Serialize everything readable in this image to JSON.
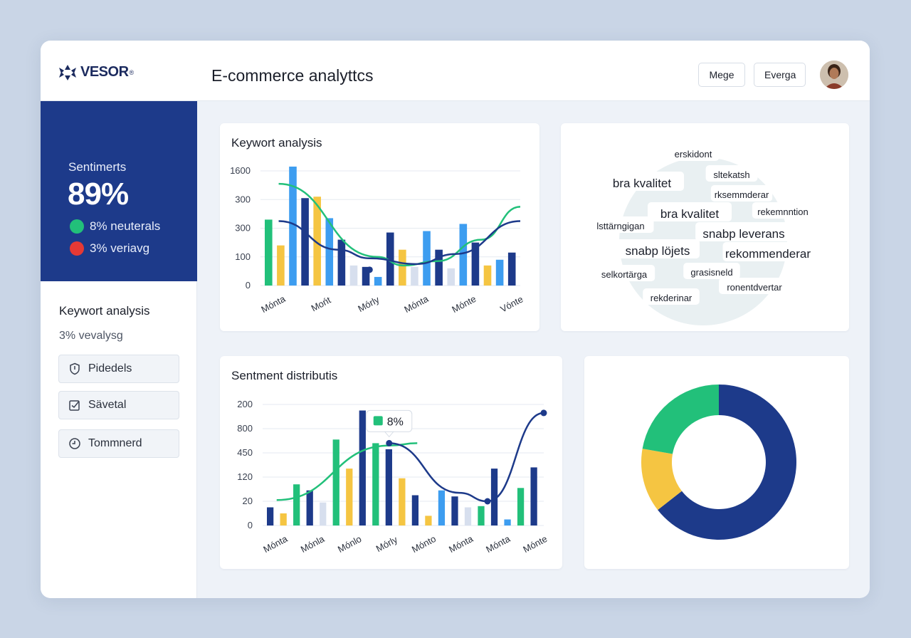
{
  "brand": {
    "name": "VESOR",
    "trademark": "®"
  },
  "header": {
    "title": "E-commerce analyttcs",
    "buttons": [
      "Mege",
      "Everga"
    ]
  },
  "colors": {
    "navy": "#1d3a8a",
    "green": "#22c07a",
    "yellow": "#f5c542",
    "blue": "#3d9df0",
    "lightgray": "#d7dfee",
    "red": "#e53935"
  },
  "sidebar": {
    "sentiment": {
      "label": "Sentimerts",
      "value": "89%",
      "rows": [
        {
          "text": "8% neuterals",
          "color": "#22c07a"
        },
        {
          "text": "3% veriavg",
          "color": "#e53935"
        }
      ]
    },
    "keyword_title": "Keywort analysis",
    "keyword_sub": "3% vevalysg",
    "buttons": [
      {
        "label": "Pidedels",
        "icon": "shield-icon"
      },
      {
        "label": "Sävetal",
        "icon": "checkbox-icon"
      },
      {
        "label": "Tommnerd",
        "icon": "clock-icon"
      }
    ]
  },
  "chart1": {
    "title": "Keywort analysis"
  },
  "wordcloud": {
    "words": [
      {
        "text": "erskidont"
      },
      {
        "text": "bra kvalitet"
      },
      {
        "text": "sltekatsh"
      },
      {
        "text": "rksemmderar"
      },
      {
        "text": "bra kvalitet"
      },
      {
        "text": "rekemnntion"
      },
      {
        "text": "lsttärngigan"
      },
      {
        "text": "snabp leverans"
      },
      {
        "text": "snabp löjets"
      },
      {
        "text": "rekommenderar"
      },
      {
        "text": "selkortärga"
      },
      {
        "text": "grasisneld"
      },
      {
        "text": "ronentdvertar"
      },
      {
        "text": "rekderinar"
      }
    ]
  },
  "chart3": {
    "title": "Sentment distributis",
    "tooltip": "8%"
  },
  "chart_data": [
    {
      "type": "bar",
      "title": "Keywort analysis",
      "yticks": [
        "1600",
        "300",
        "300",
        "100",
        "0"
      ],
      "xticks": [
        "Mónta",
        "Mońt",
        "Mórly",
        "Mónta",
        "Mónte",
        "Vónte"
      ],
      "ylim": [
        0,
        400
      ],
      "grid": true,
      "groups": [
        {
          "bars": [
            {
              "color": "green",
              "value": 230
            },
            {
              "color": "yellow",
              "value": 140
            },
            {
              "color": "blue",
              "value": 415
            },
            {
              "color": "navy",
              "value": 305
            }
          ]
        },
        {
          "bars": [
            {
              "color": "yellow",
              "value": 310
            },
            {
              "color": "blue",
              "value": 235
            },
            {
              "color": "navy",
              "value": 160
            },
            {
              "color": "lightgray",
              "value": 70
            }
          ]
        },
        {
          "bars": [
            {
              "color": "navy",
              "value": 65
            },
            {
              "color": "blue",
              "value": 30
            },
            {
              "color": "navy",
              "value": 185
            },
            {
              "color": "yellow",
              "value": 125
            }
          ]
        },
        {
          "bars": [
            {
              "color": "lightgray",
              "value": 65
            },
            {
              "color": "blue",
              "value": 190
            },
            {
              "color": "navy",
              "value": 125
            }
          ]
        },
        {
          "bars": [
            {
              "color": "lightgray",
              "value": 60
            },
            {
              "color": "blue",
              "value": 215
            },
            {
              "color": "navy",
              "value": 150
            }
          ]
        },
        {
          "bars": [
            {
              "color": "yellow",
              "value": 70
            },
            {
              "color": "blue",
              "value": 90
            },
            {
              "color": "navy",
              "value": 115
            }
          ]
        }
      ],
      "lines": [
        {
          "color": "green",
          "points": [
            [
              0.07,
              355
            ],
            [
              0.45,
              100
            ],
            [
              0.55,
              70
            ],
            [
              0.68,
              85
            ],
            [
              0.85,
              160
            ],
            [
              1.0,
              275
            ]
          ]
        },
        {
          "color": "navy",
          "points": [
            [
              0.07,
              225
            ],
            [
              0.3,
              125
            ],
            [
              0.42,
              95
            ],
            [
              0.6,
              75
            ],
            [
              0.75,
              110
            ],
            [
              1.0,
              225
            ]
          ]
        }
      ],
      "marker": {
        "point": [
          0.42,
          55
        ]
      }
    },
    {
      "type": "bar",
      "title": "Sentment distributis",
      "yticks": [
        "200",
        "800",
        "450",
        "120",
        "20",
        "0"
      ],
      "xticks": [
        "Mónta",
        "Mónla",
        "Mónlo",
        "Mórly",
        "Mónto",
        "Mónta",
        "Mónta",
        "Mónte"
      ],
      "ylim": [
        0,
        500
      ],
      "grid": true,
      "groups": [
        {
          "bars": [
            {
              "color": "navy",
              "value": 75
            },
            {
              "color": "yellow",
              "value": 50
            }
          ]
        },
        {
          "bars": [
            {
              "color": "green",
              "value": 170
            },
            {
              "color": "navy",
              "value": 145
            }
          ]
        },
        {
          "bars": [
            {
              "color": "lightgray",
              "value": 95
            },
            {
              "color": "green",
              "value": 355
            }
          ]
        },
        {
          "bars": [
            {
              "color": "yellow",
              "value": 235
            },
            {
              "color": "navy",
              "value": 475
            }
          ]
        },
        {
          "bars": [
            {
              "color": "green",
              "value": 340
            },
            {
              "color": "navy",
              "value": 315
            }
          ]
        },
        {
          "bars": [
            {
              "color": "yellow",
              "value": 195
            },
            {
              "color": "navy",
              "value": 125
            }
          ]
        },
        {
          "bars": [
            {
              "color": "yellow",
              "value": 40
            },
            {
              "color": "blue",
              "value": 145
            }
          ]
        },
        {
          "bars": [
            {
              "color": "navy",
              "value": 120
            },
            {
              "color": "lightgray",
              "value": 75
            }
          ]
        },
        {
          "bars": [
            {
              "color": "green",
              "value": 80
            },
            {
              "color": "navy",
              "value": 235
            }
          ]
        },
        {
          "bars": [
            {
              "color": "blue",
              "value": 25
            },
            {
              "color": "green",
              "value": 155
            },
            {
              "color": "navy",
              "value": 240
            }
          ]
        }
      ],
      "lines": [
        {
          "color": "green",
          "points": [
            [
              0.05,
              105
            ],
            [
              0.45,
              330
            ],
            [
              0.55,
              340
            ]
          ]
        },
        {
          "color": "navy",
          "points": [
            [
              0.45,
              340
            ],
            [
              0.7,
              135
            ],
            [
              0.8,
              100
            ],
            [
              1.0,
              465
            ]
          ]
        }
      ]
    },
    {
      "type": "pie",
      "donut": true,
      "slices": [
        {
          "color": "navy",
          "value": 58
        },
        {
          "color": "yellow",
          "value": 12
        },
        {
          "color": "green",
          "value": 20
        }
      ]
    }
  ]
}
